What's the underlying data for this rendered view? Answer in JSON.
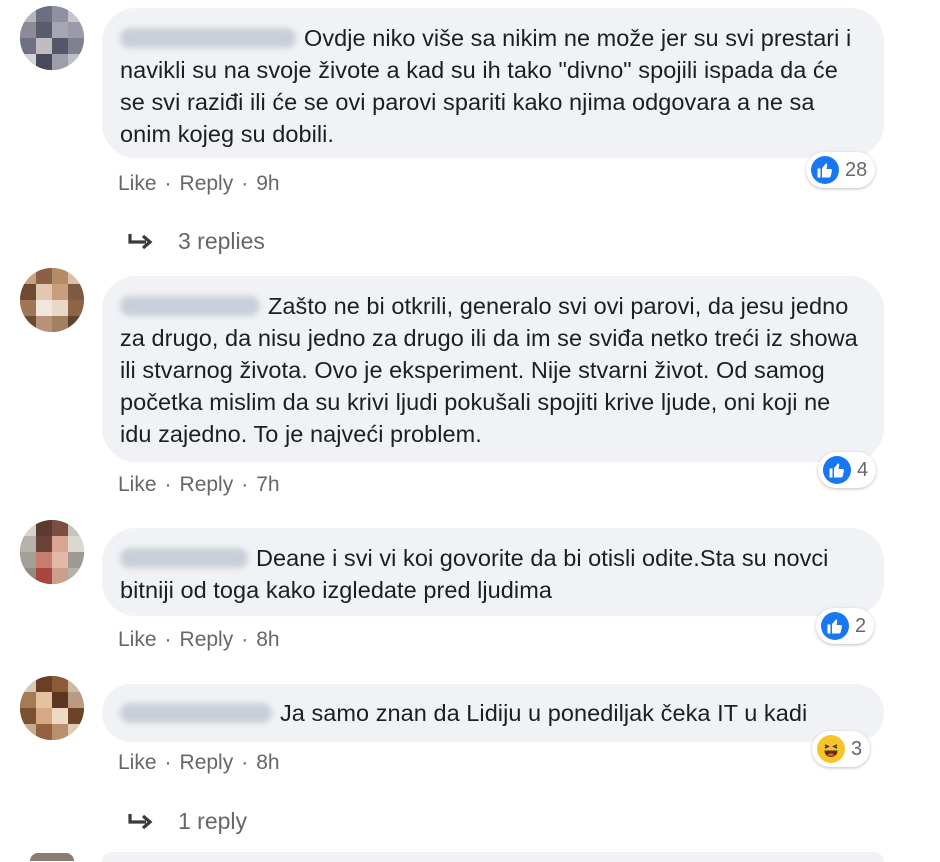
{
  "comments": [
    {
      "text": "Ovdje niko više sa nikim ne može jer su svi prestari i navikli su na svoje živote a kad su ih tako \"divno\" spojili ispada da će se svi raziđi ili će se ovi parovi spariti kako njima odgovara a ne sa onim kojeg su dobili.",
      "reaction_icon": "like-reaction-icon",
      "reaction_count": "28",
      "like": "Like",
      "reply": "Reply",
      "time": "9h",
      "replies_label": "3 replies"
    },
    {
      "text": "Zašto ne bi otkrili, generalo svi ovi parovi, da jesu jedno za drugo, da nisu jedno za drugo ili da im se sviđa netko treći iz showa ili stvarnog života. Ovo je eksperiment. Nije stvarni život. Od samog početka mislim da su krivi ljudi pokušali spojiti krive ljude, oni koji ne idu zajedno. To je najveći problem.",
      "reaction_icon": "like-reaction-icon",
      "reaction_count": "4",
      "like": "Like",
      "reply": "Reply",
      "time": "7h"
    },
    {
      "text": "Deane i svi vi koi govorite da bi otisli odite.Sta su novci bitniji od toga kako izgledate pred ljudima",
      "reaction_icon": "like-reaction-icon",
      "reaction_count": "2",
      "like": "Like",
      "reply": "Reply",
      "time": "8h"
    },
    {
      "text": "Ja samo znan da Lidiju u ponediljak čeka IT u kadi",
      "reaction_icon": "haha-reaction-icon",
      "reaction_count": "3",
      "like": "Like",
      "reply": "Reply",
      "time": "8h",
      "replies_label": "1 reply"
    }
  ],
  "colors": {
    "bubble": "#f0f2f5",
    "meta_text": "#65676b",
    "like_blue": "#1877f2",
    "haha_yellow": "#f7c52b"
  }
}
